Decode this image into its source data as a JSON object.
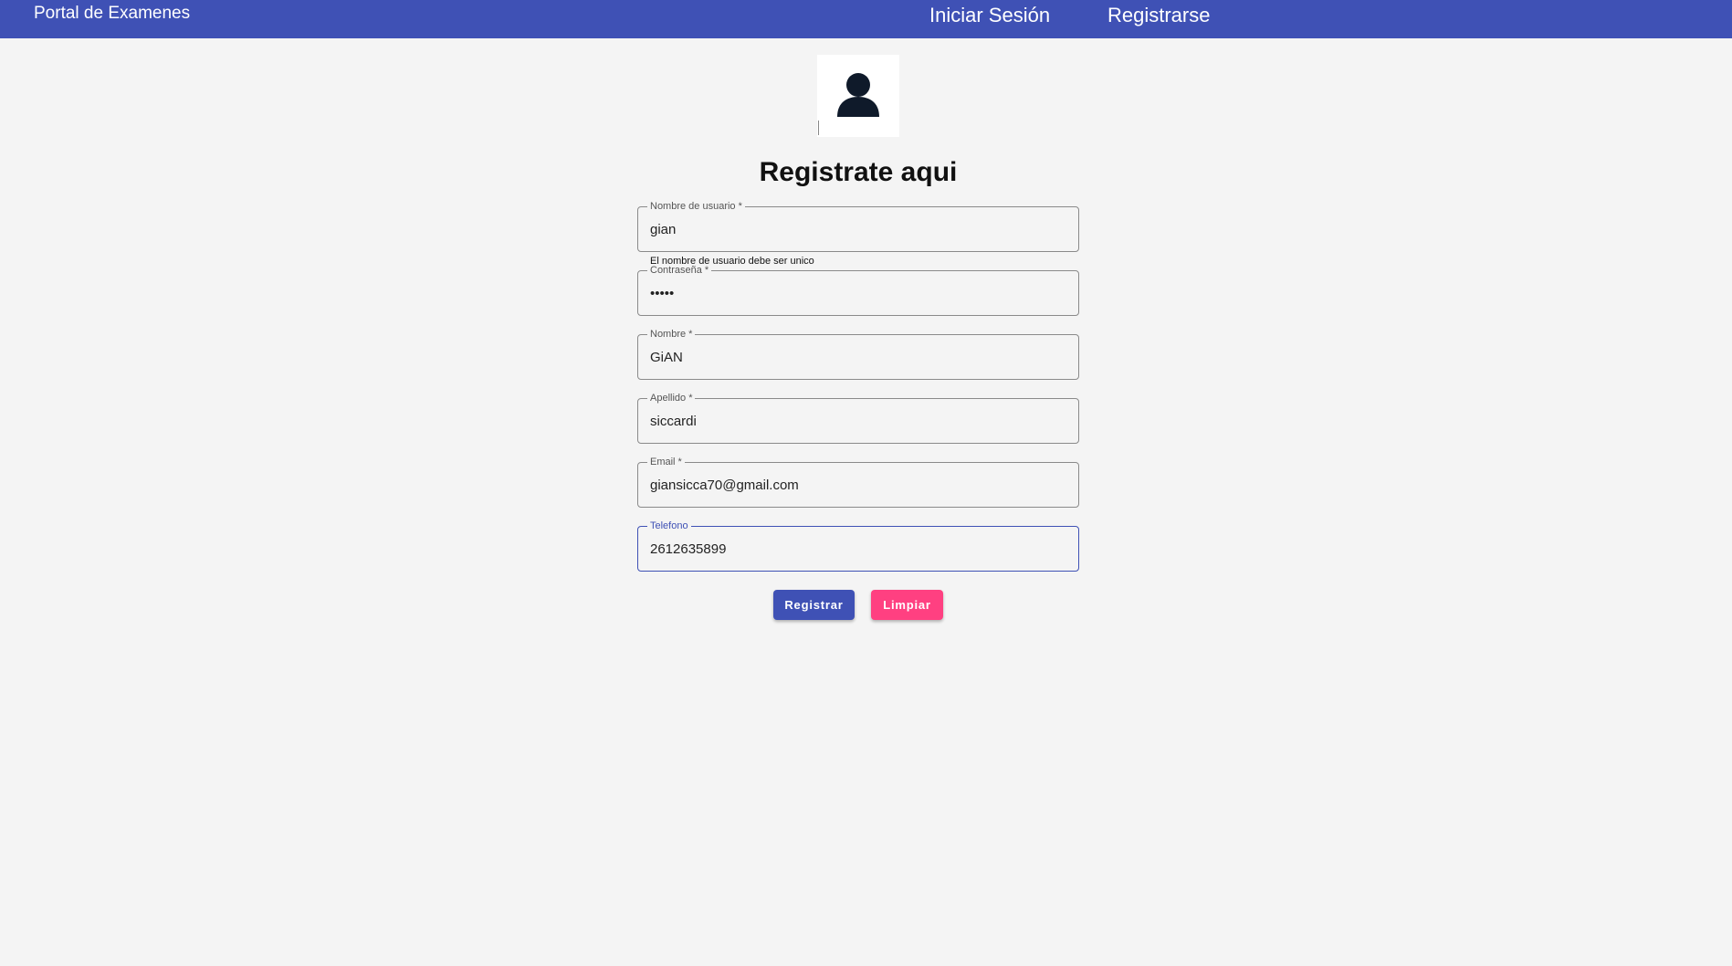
{
  "header": {
    "brand": "Portal de Examenes",
    "login_link": "Iniciar Sesión",
    "register_link": "Registrarse"
  },
  "avatar": {
    "icon": "user-icon"
  },
  "form": {
    "title": "Registrate aqui",
    "username": {
      "label": "Nombre de usuario *",
      "value": "gian",
      "hint": "El nombre de usuario debe ser unico"
    },
    "password": {
      "label": "Contraseña *",
      "value": "•••••"
    },
    "name": {
      "label": "Nombre *",
      "value": "GiAN"
    },
    "lastname": {
      "label": "Apellido *",
      "value": "siccardi"
    },
    "email": {
      "label": "Email *",
      "value": "giansicca70@gmail.com"
    },
    "phone": {
      "label": "Telefono",
      "value": "2612635899"
    },
    "submit_label": "Registrar",
    "clear_label": "Limpiar"
  },
  "colors": {
    "primary": "#3f51b5",
    "accent": "#ff4081",
    "background": "#f4f4f4"
  }
}
